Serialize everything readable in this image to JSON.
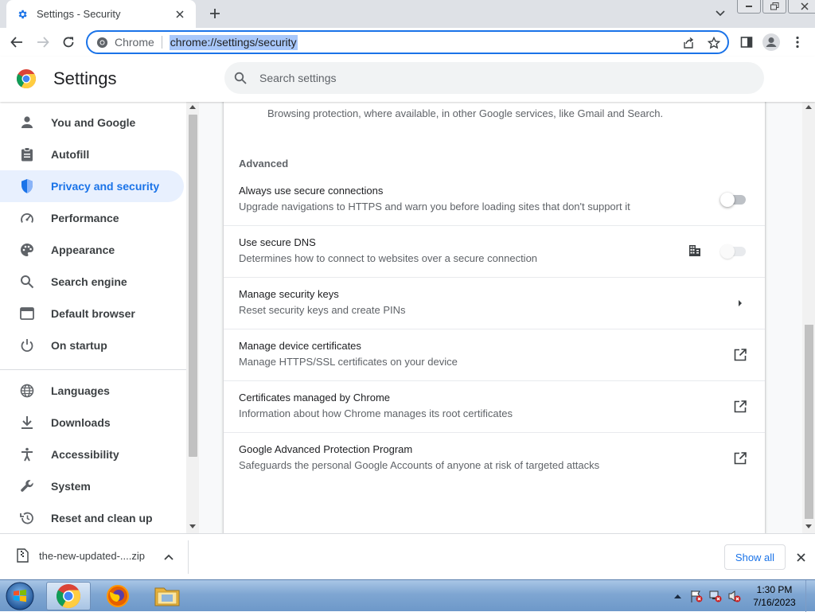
{
  "window": {
    "tab_title": "Settings - Security",
    "new_tab_label": "+"
  },
  "omnibox": {
    "chip": "Chrome",
    "url": "chrome://settings/security"
  },
  "header": {
    "title": "Settings",
    "search_placeholder": "Search settings"
  },
  "sidebar": {
    "items": [
      {
        "label": "You and Google",
        "icon": "person-icon",
        "active": false
      },
      {
        "label": "Autofill",
        "icon": "clipboard-icon",
        "active": false
      },
      {
        "label": "Privacy and security",
        "icon": "shield-icon",
        "active": true
      },
      {
        "label": "Performance",
        "icon": "speedometer-icon",
        "active": false
      },
      {
        "label": "Appearance",
        "icon": "palette-icon",
        "active": false
      },
      {
        "label": "Search engine",
        "icon": "search-icon",
        "active": false
      },
      {
        "label": "Default browser",
        "icon": "browser-icon",
        "active": false
      },
      {
        "label": "On startup",
        "icon": "power-icon",
        "active": false
      },
      {
        "label": "Languages",
        "icon": "globe-icon",
        "active": false
      },
      {
        "label": "Downloads",
        "icon": "download-icon",
        "active": false
      },
      {
        "label": "Accessibility",
        "icon": "accessibility-icon",
        "active": false
      },
      {
        "label": "System",
        "icon": "wrench-icon",
        "active": false
      },
      {
        "label": "Reset and clean up",
        "icon": "restore-icon",
        "active": false
      }
    ]
  },
  "main": {
    "top_text": "Browsing protection, where available, in other Google services, like Gmail and Search.",
    "section_heading": "Advanced",
    "rows": [
      {
        "title": "Always use secure connections",
        "subtitle": "Upgrade navigations to HTTPS and warn you before loading sites that don't support it",
        "action": "toggle",
        "state": "off"
      },
      {
        "title": "Use secure DNS",
        "subtitle": "Determines how to connect to websites over a secure connection",
        "action": "toggle-disabled",
        "state": "off",
        "policy_icon": "enterprise-icon"
      },
      {
        "title": "Manage security keys",
        "subtitle": "Reset security keys and create PINs",
        "action": "arrow"
      },
      {
        "title": "Manage device certificates",
        "subtitle": "Manage HTTPS/SSL certificates on your device",
        "action": "external-link"
      },
      {
        "title": "Certificates managed by Chrome",
        "subtitle": "Information about how Chrome manages its root certificates",
        "action": "external-link"
      },
      {
        "title": "Google Advanced Protection Program",
        "subtitle": "Safeguards the personal Google Accounts of anyone at risk of targeted attacks",
        "action": "external-link"
      }
    ]
  },
  "downloads": {
    "file_name": "the-new-updated-....zip",
    "show_all": "Show all"
  },
  "taskbar": {
    "time": "1:30 PM",
    "date": "7/16/2023"
  },
  "colors": {
    "accent": "#1a73e8",
    "active_nav_bg": "#e8f0fe",
    "url_highlight": "#a8c7fa"
  }
}
